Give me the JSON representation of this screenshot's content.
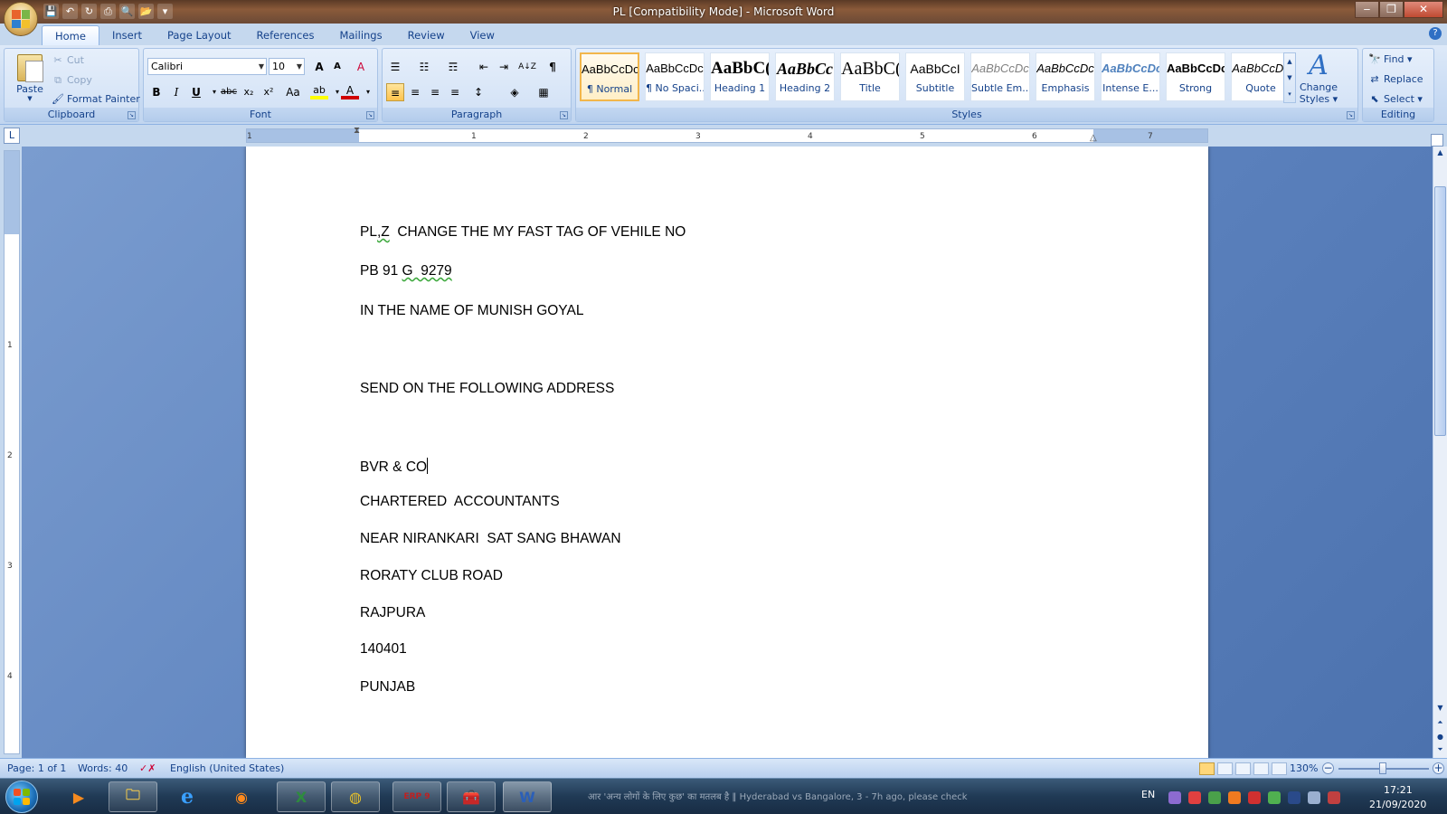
{
  "window": {
    "title": "PL [Compatibility Mode] - Microsoft Word",
    "controls": {
      "minimize": "‒",
      "restore": "❐",
      "close": "✕"
    }
  },
  "quick_access": {
    "save": "💾",
    "undo": "↶",
    "redo": "↻",
    "print": "⎙",
    "preview": "🔍",
    "open": "📂",
    "more": "▾"
  },
  "ribbon_tabs": [
    "Home",
    "Insert",
    "Page Layout",
    "References",
    "Mailings",
    "Review",
    "View"
  ],
  "clipboard": {
    "paste_label": "Paste",
    "cut_label": "Cut",
    "copy_label": "Copy",
    "format_painter_label": "Format Painter",
    "group_title": "Clipboard"
  },
  "font": {
    "font_name": "Calibri",
    "font_size": "10",
    "group_title": "Font",
    "grow": "A",
    "shrink": "A",
    "clear": "A",
    "bold": "B",
    "italic": "I",
    "underline": "U",
    "strike": "abc",
    "subscript": "x₂",
    "superscript": "x²",
    "change_case": "Aa",
    "highlight": "ab",
    "font_color": "A"
  },
  "paragraph": {
    "group_title": "Paragraph",
    "bullets": "☰",
    "numbering": "☷",
    "multilevel": "☶",
    "decrease_indent": "⇤",
    "increase_indent": "⇥",
    "sort": "A↓Z",
    "show_marks": "¶",
    "align_left": "≡",
    "center": "≡",
    "align_right": "≡",
    "justify": "≡",
    "line_spacing": "↕",
    "shading": "◈",
    "borders": "▦"
  },
  "styles": {
    "group_title": "Styles",
    "items": [
      {
        "sample": "AaBbCcDc",
        "name": "¶ Normal"
      },
      {
        "sample": "AaBbCcDc",
        "name": "¶ No Spaci..."
      },
      {
        "sample": "AaBbC(",
        "name": "Heading 1"
      },
      {
        "sample": "AaBbCc",
        "name": "Heading 2"
      },
      {
        "sample": "AaBbC(",
        "name": "Title"
      },
      {
        "sample": "AaBbCcI",
        "name": "Subtitle"
      },
      {
        "sample": "AaBbCcDc",
        "name": "Subtle Em..."
      },
      {
        "sample": "AaBbCcDc",
        "name": "Emphasis"
      },
      {
        "sample": "AaBbCcDc",
        "name": "Intense E..."
      },
      {
        "sample": "AaBbCcDc",
        "name": "Strong"
      },
      {
        "sample": "AaBbCcDc",
        "name": "Quote"
      }
    ],
    "change_styles_icon": "A",
    "change_styles_label_1": "Change",
    "change_styles_label_2": "Styles"
  },
  "editing": {
    "group_title": "Editing",
    "find_label": "Find",
    "replace_label": "Replace",
    "select_label": "Select"
  },
  "ruler": {
    "tab_selector": "L",
    "h_ticks": [
      "1",
      "1",
      "2",
      "3",
      "4",
      "5",
      "6",
      "7"
    ],
    "v_ticks": [
      "1",
      "2",
      "3",
      "4"
    ]
  },
  "document": {
    "lines": [
      "PL,Z  CHANGE THE MY FAST TAG OF VEHILE NO",
      "PB 91 G  9279",
      "IN THE NAME OF MUNISH GOYAL",
      "SEND ON THE FOLLOWING ADDRESS",
      "BVR & CO",
      "CHARTERED  ACCOUNTANTS",
      "NEAR NIRANKARI  SAT SANG BHAWAN",
      "RORATY CLUB ROAD",
      "RAJPURA",
      "140401",
      "PUNJAB"
    ],
    "line1_pre": "PL",
    "line1_err": ",Z",
    "line1_post": "  CHANGE THE MY FAST TAG OF VEHILE NO",
    "line2_pre": "PB 91 ",
    "line2_err": "G  9279"
  },
  "statusbar": {
    "page": "Page: 1 of 1",
    "words": "Words: 40",
    "language": "English (United States)",
    "zoom": "130%",
    "zoom_out": "−",
    "zoom_in": "+"
  },
  "taskbar": {
    "excel_label": "X",
    "word_label": "W",
    "tally_label": "ERP 9",
    "tray_lang": "EN",
    "time": "17:21",
    "date": "21/09/2020",
    "ticker": "आर 'अन्य लोगों के लिए कुछ' का मतलब है ‖ Hyderabad vs Bangalore, 3 - 7h ago, please check"
  },
  "colors": {
    "ribbon_text": "#15428b",
    "spell_squiggle": "#3ca83c",
    "selected_style_border": "#f2b64b",
    "font_color_bar": "#d00000",
    "highlight_bar": "#ffff00"
  }
}
